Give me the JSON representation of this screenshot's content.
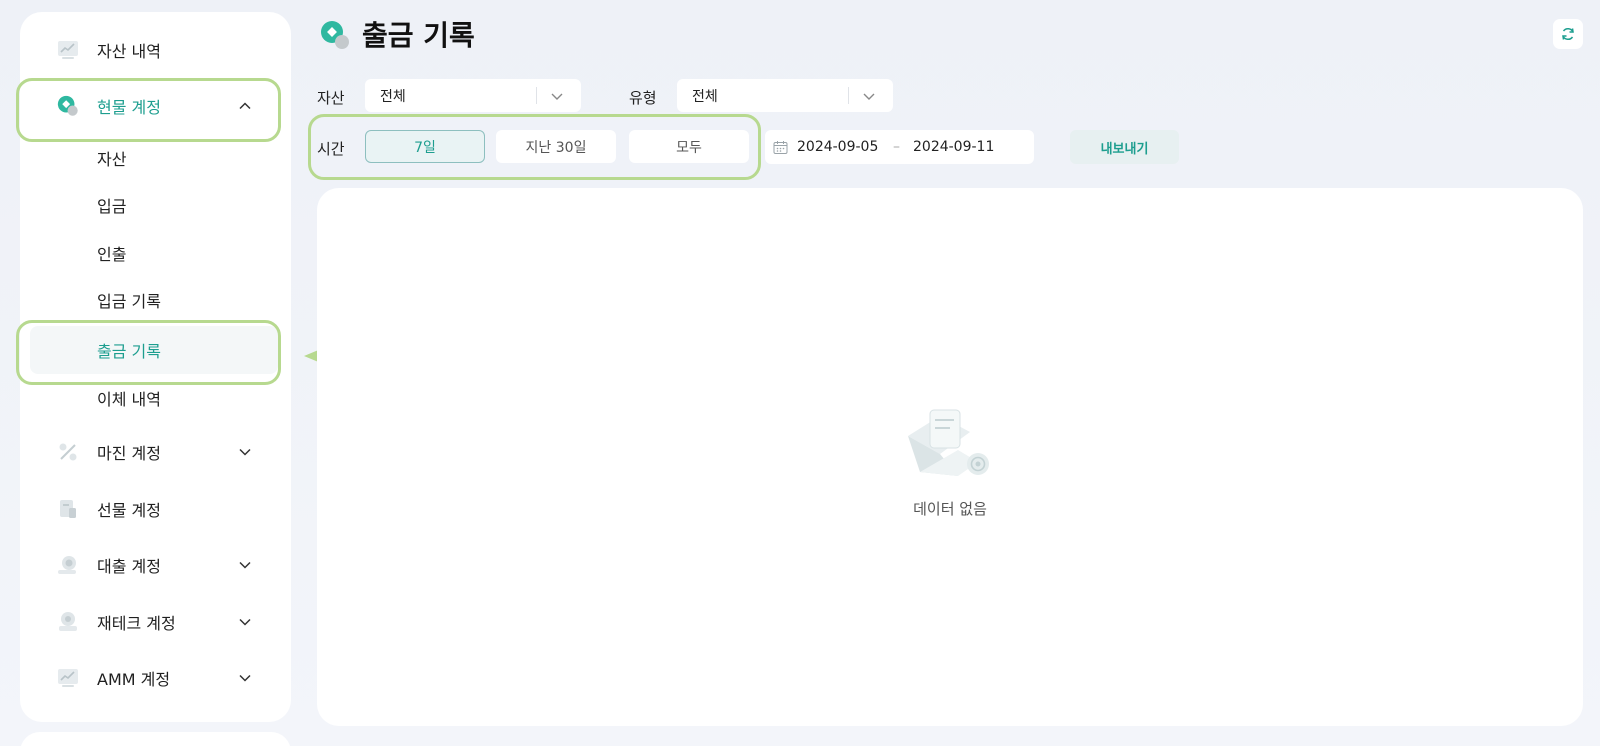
{
  "sidebar": {
    "items": [
      {
        "label": "자산 내역"
      },
      {
        "label": "현물 계정"
      },
      {
        "label": "마진 계정"
      },
      {
        "label": "선물 계정"
      },
      {
        "label": "대출 계정"
      },
      {
        "label": "재테크 계정"
      },
      {
        "label": "AMM 계정"
      }
    ],
    "sub_items": [
      {
        "label": "자산"
      },
      {
        "label": "입금"
      },
      {
        "label": "인출"
      },
      {
        "label": "입금 기록"
      },
      {
        "label": "출금 기록"
      },
      {
        "label": "이체 내역"
      }
    ]
  },
  "header": {
    "title": "출금 기록"
  },
  "filters": {
    "asset_label": "자산",
    "asset_value": "전체",
    "type_label": "유형",
    "type_value": "전체",
    "time_label": "시간",
    "time_options": [
      "7일",
      "지난 30일",
      "모두"
    ],
    "selected_time": "7일",
    "date_start": "2024-09-05",
    "date_sep": "–",
    "date_end": "2024-09-11",
    "export_label": "내보내기"
  },
  "content": {
    "empty_text": "데이터 없음"
  },
  "colors": {
    "accent": "#1d9e8f",
    "highlight": "#b7d98f",
    "arrow": "#b7d98f"
  }
}
